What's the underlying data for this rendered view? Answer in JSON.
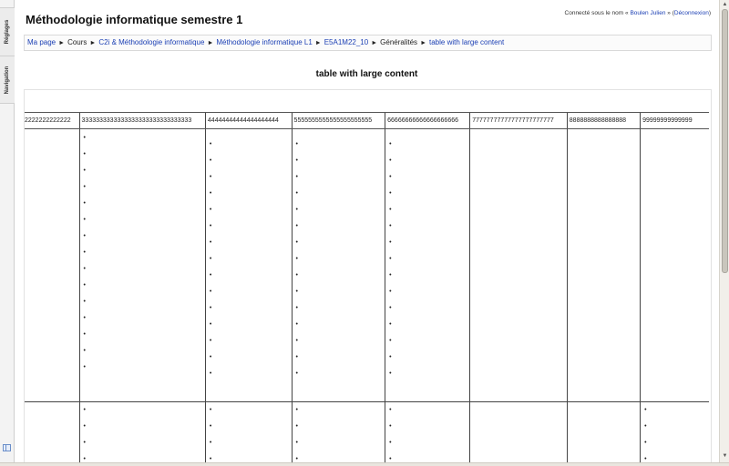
{
  "header": {
    "title": "Méthodologie informatique semestre 1",
    "login_prefix": "Connecté sous le nom «",
    "user_name": "Boulen Julien",
    "login_mid": "» (",
    "logout_label": "Déconnexion",
    "login_suffix": ")"
  },
  "breadcrumb": {
    "separator": "►",
    "items": [
      {
        "label": "Ma page",
        "link": true
      },
      {
        "label": "Cours",
        "link": false
      },
      {
        "label": "C2i & Méthodologie informatique",
        "link": true
      },
      {
        "label": "Méthodologie informatique L1",
        "link": true
      },
      {
        "label": "E5A1M22_10",
        "link": true
      },
      {
        "label": "Généralités",
        "link": false
      },
      {
        "label": "table with large content",
        "link": true
      }
    ]
  },
  "sidebar": {
    "tabs": [
      "Réglages",
      "Navigation"
    ]
  },
  "section": {
    "heading": "table with large content"
  },
  "table": {
    "columns": [
      "2222222222222",
      "3333333333333333333333333333333",
      "44444444444444444444",
      "5555555555555555555555",
      "66666666666666666666",
      "77777777777777777777777",
      "8888888888888888",
      "99999999999999"
    ],
    "bullet": "•",
    "rows": [
      {
        "bullets_per_column": [
          0,
          15,
          15,
          15,
          15,
          0,
          0,
          0
        ]
      },
      {
        "bullets_per_column": [
          0,
          4,
          4,
          4,
          4,
          0,
          0,
          4
        ]
      }
    ]
  },
  "scrollbar": {
    "up_glyph": "▲",
    "down_glyph": "▼"
  }
}
